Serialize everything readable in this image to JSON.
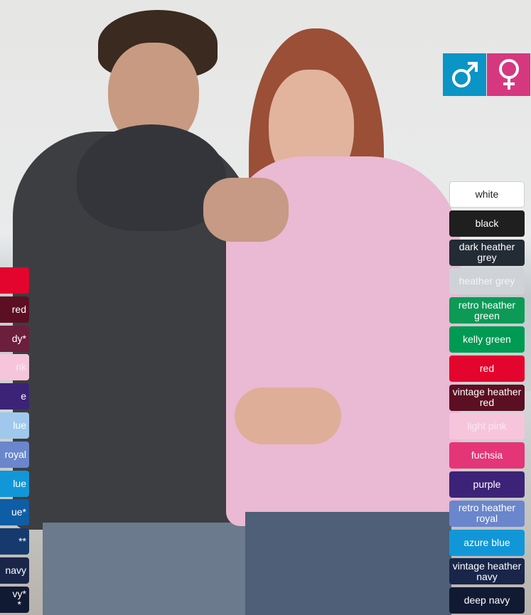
{
  "gender_icons": [
    {
      "name": "male",
      "symbol": "male-icon",
      "color": "#0b94c6"
    },
    {
      "name": "female",
      "symbol": "female-icon",
      "color": "#d6387f"
    }
  ],
  "right_swatches": [
    {
      "label": "white",
      "bg": "#ffffff",
      "fg": "#222222"
    },
    {
      "label": "black",
      "bg": "#1f1f1f",
      "fg": "#ffffff"
    },
    {
      "label": "dark heather\ngrey",
      "bg": "#232b35",
      "fg": "#ffffff"
    },
    {
      "label": "heather grey",
      "bg": "#cfd3d7",
      "fg": "#f4f4f4"
    },
    {
      "label": "retro heather\ngreen",
      "bg": "#0d9a57",
      "fg": "#ffffff"
    },
    {
      "label": "kelly green",
      "bg": "#009a53",
      "fg": "#ffffff"
    },
    {
      "label": "red",
      "bg": "#e3052d",
      "fg": "#ffffff"
    },
    {
      "label": "vintage heather\nred",
      "bg": "#5c0f22",
      "fg": "#ffffff"
    },
    {
      "label": "light pink",
      "bg": "#f6c5dc",
      "fg": "#fbe8f1"
    },
    {
      "label": "fuchsia",
      "bg": "#e43577",
      "fg": "#ffffff"
    },
    {
      "label": "purple",
      "bg": "#3c2377",
      "fg": "#ffffff"
    },
    {
      "label": "retro heather\nroyal",
      "bg": "#6a86cc",
      "fg": "#ffffff"
    },
    {
      "label": "azure blue",
      "bg": "#1197d8",
      "fg": "#ffffff"
    },
    {
      "label": "vintage heather\nnavy",
      "bg": "#19264a",
      "fg": "#ffffff"
    },
    {
      "label": "deep navy",
      "bg": "#111a33",
      "fg": "#ffffff"
    }
  ],
  "left_swatches": [
    {
      "label": "",
      "bg": "#e3052d",
      "fg": "#ffffff"
    },
    {
      "label": "red",
      "bg": "#5c0f22",
      "fg": "#ffffff"
    },
    {
      "label": "dy*",
      "bg": "#6b1f3c",
      "fg": "#ffffff"
    },
    {
      "label": "nk",
      "bg": "#f6c5dc",
      "fg": "#fbe8f1"
    },
    {
      "label": "e",
      "bg": "#3c2377",
      "fg": "#ffffff"
    },
    {
      "label": "lue",
      "bg": "#9fc8ec",
      "fg": "#ffffff"
    },
    {
      "label": "royal",
      "bg": "#6a86cc",
      "fg": "#ffffff"
    },
    {
      "label": "lue",
      "bg": "#1197d8",
      "fg": "#ffffff"
    },
    {
      "label": "ue*",
      "bg": "#0f5da6",
      "fg": "#ffffff"
    },
    {
      "label": "**",
      "bg": "#163a6e",
      "fg": "#ffffff"
    },
    {
      "label": "navy",
      "bg": "#19264a",
      "fg": "#ffffff"
    },
    {
      "label": "vy*\n*",
      "bg": "#111a33",
      "fg": "#ffffff"
    }
  ]
}
